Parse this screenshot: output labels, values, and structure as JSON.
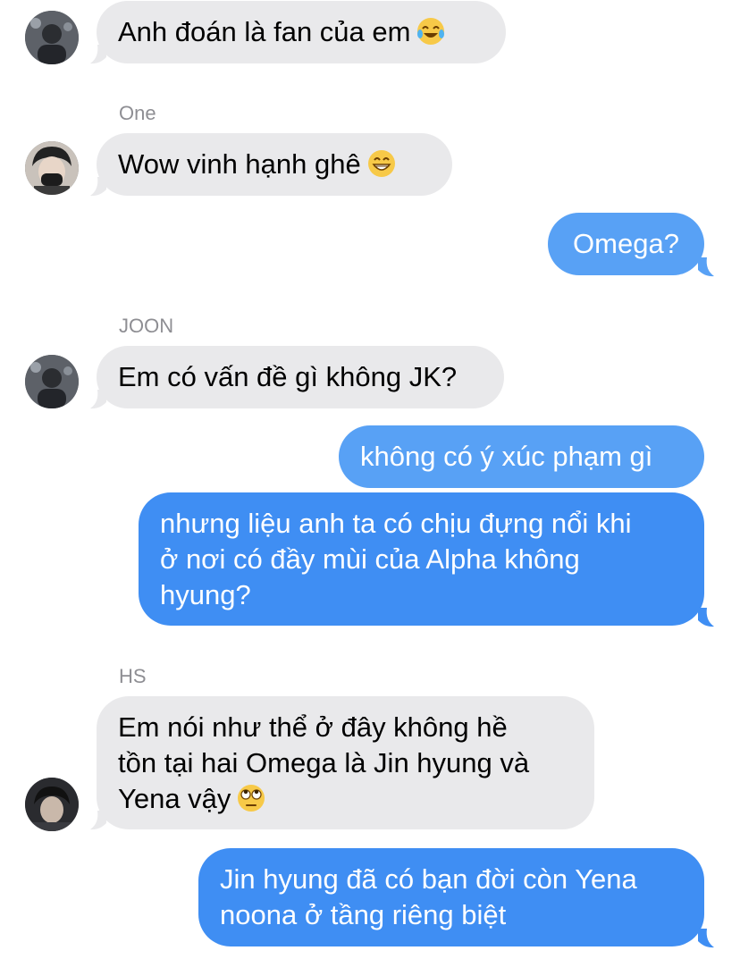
{
  "conversation": {
    "messages": [
      {
        "type": "incoming",
        "sender": "",
        "text": "Anh đoán là fan của em",
        "emoji": "tears-of-joy"
      },
      {
        "type": "incoming",
        "sender": "One",
        "text": "Wow vinh hạnh ghê",
        "emoji": "grinning"
      },
      {
        "type": "outgoing",
        "text": "Omega?"
      },
      {
        "type": "incoming",
        "sender": "JOON",
        "text": "Em có vấn đề gì không JK?"
      },
      {
        "type": "outgoing",
        "text": "không có ý xúc phạm gì"
      },
      {
        "type": "outgoing",
        "text_lines": [
          "nhưng liệu anh ta có chịu đựng nổi khi",
          "ở nơi có đầy mùi của Alpha không",
          "hyung?"
        ]
      },
      {
        "type": "incoming",
        "sender": "HS",
        "text_lines": [
          "Em nói như thể ở đây không hề",
          "tồn tại hai Omega là Jin hyung và",
          "Yena vậy"
        ],
        "emoji": "rolling-eyes"
      },
      {
        "type": "outgoing",
        "text_lines": [
          "Jin hyung đã có bạn đời còn Yena",
          "noona ở tầng riêng biệt"
        ]
      }
    ]
  },
  "colors": {
    "incoming_bubble": "#e9e9eb",
    "outgoing_bubble": "#3f8ef3",
    "sender_label": "#8e8e93"
  }
}
